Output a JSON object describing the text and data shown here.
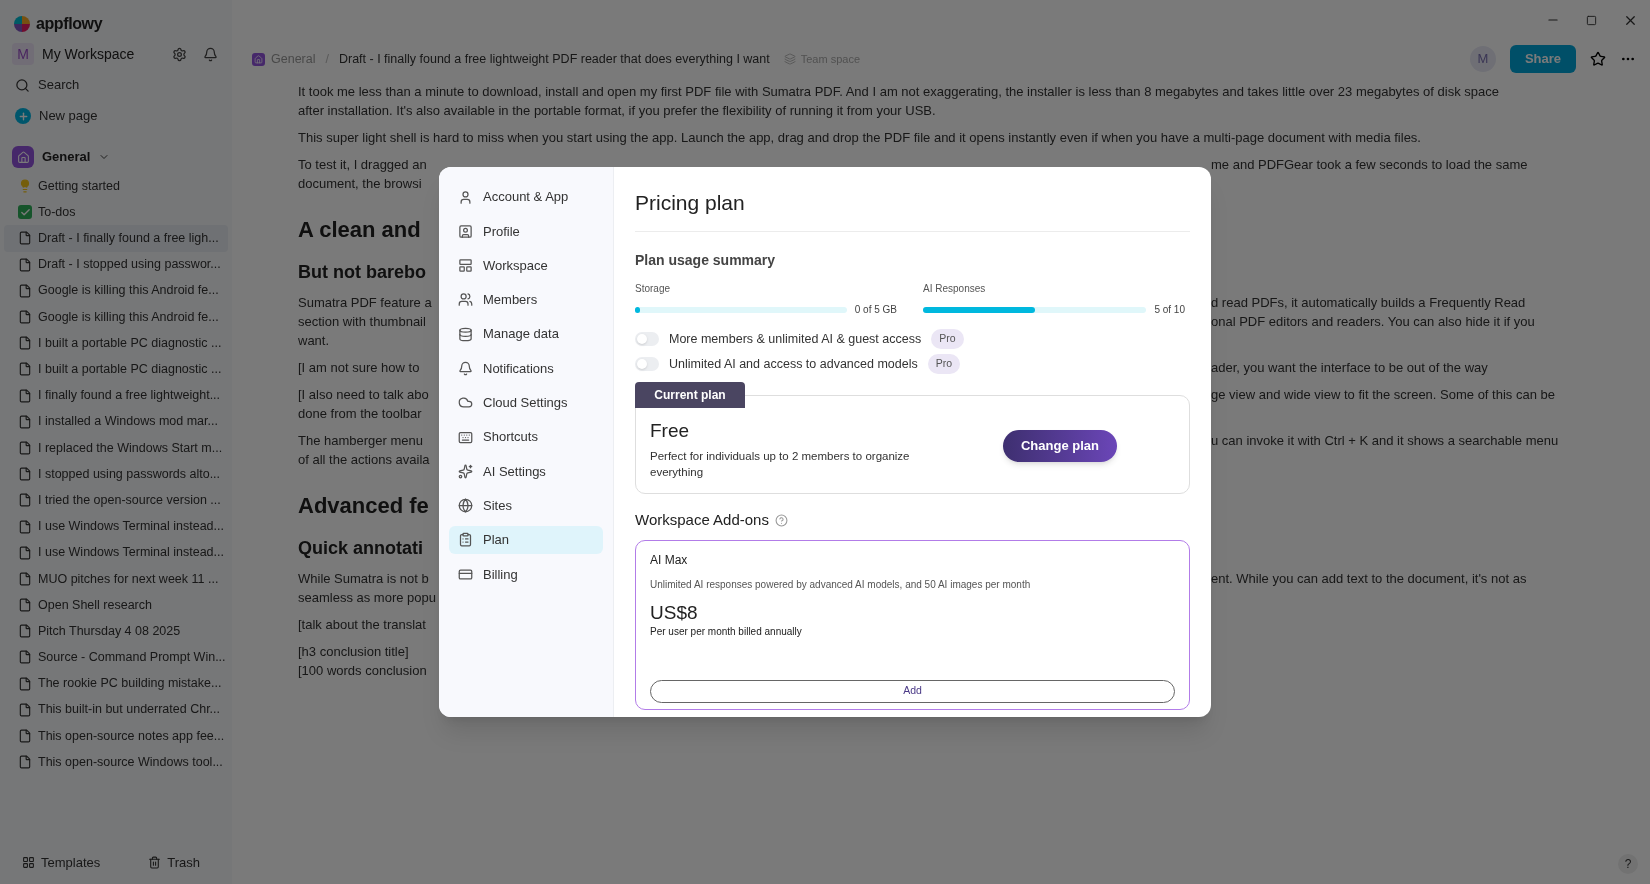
{
  "app": {
    "logo_text": "appflowy"
  },
  "sidebar": {
    "workspace": {
      "avatar": "M",
      "name": "My Workspace"
    },
    "actions": [
      {
        "label": "Search"
      },
      {
        "label": "New page"
      }
    ],
    "space": {
      "label": "General",
      "expanded": true,
      "pages": [
        {
          "label": "Getting started",
          "selected": false
        },
        {
          "label": "To-dos",
          "selected": false
        },
        {
          "label": "Draft - I finally found a free ligh...",
          "selected": true
        },
        {
          "label": "Draft - I stopped using passwor...",
          "selected": false
        },
        {
          "label": "Google is killing this Android fe...",
          "selected": false
        },
        {
          "label": "Google is killing this Android fe...",
          "selected": false
        },
        {
          "label": "I built a portable PC diagnostic ...",
          "selected": false
        },
        {
          "label": "I built a portable PC diagnostic ...",
          "selected": false
        },
        {
          "label": "I finally found a free lightweight...",
          "selected": false
        },
        {
          "label": "I installed a Windows mod mar...",
          "selected": false
        },
        {
          "label": "I replaced the Windows Start m...",
          "selected": false
        },
        {
          "label": "I stopped using passwords alto...",
          "selected": false
        },
        {
          "label": "I tried the open-source version ...",
          "selected": false
        },
        {
          "label": "I use Windows Terminal instead...",
          "selected": false
        },
        {
          "label": "I use Windows Terminal instead...",
          "selected": false
        },
        {
          "label": "MUO pitches for next week 11 ...",
          "selected": false
        },
        {
          "label": "Open Shell research",
          "selected": false
        },
        {
          "label": "Pitch Thursday 4 08 2025",
          "selected": false
        },
        {
          "label": "Source - Command Prompt Win...",
          "selected": false
        },
        {
          "label": "The rookie PC building mistake...",
          "selected": false
        },
        {
          "label": "This built-in but underrated Chr...",
          "selected": false
        },
        {
          "label": "This open-source notes app fee...",
          "selected": false
        },
        {
          "label": "This open-source Windows tool...",
          "selected": false
        }
      ]
    },
    "footer": [
      {
        "label": "Templates"
      },
      {
        "label": "Trash"
      }
    ]
  },
  "header": {
    "breadcrumbs": [
      {
        "label": "General"
      },
      {
        "label": "Draft - I finally found a free lightweight PDF reader that does everything I want"
      }
    ],
    "separator": "/",
    "badge": "Team space",
    "avatar": "M",
    "share": "Share"
  },
  "document": [
    {
      "kind": "p",
      "lines": [
        {
          "left": "It took me less than a minute to download, install and open my first PDF file with Sumatra PDF. And I am not exaggerating, the installer is less than 8 megabytes and takes little over 23 megabytes of disk space"
        },
        {
          "left": "after installation. It's also available in the portable format, if you prefer the flexibility of running it from your USB."
        }
      ]
    },
    {
      "kind": "p",
      "lines": [
        {
          "left": "This super light shell is hard to miss when you start using the app. Launch the app, drag and drop the PDF file and it opens instantly even if when you have a multi-page document with media files."
        }
      ]
    },
    {
      "kind": "p",
      "lines": [
        {
          "left": "To test it, I dragged an",
          "right": "me and PDFGear took a few seconds to load the same"
        },
        {
          "left": "document, the browsi"
        }
      ]
    },
    {
      "kind": "h2",
      "lines": [
        {
          "left": "A clean and"
        }
      ]
    },
    {
      "kind": "h3",
      "lines": [
        {
          "left": "But not barebo"
        }
      ]
    },
    {
      "kind": "p",
      "lines": [
        {
          "left": "Sumatra PDF feature a",
          "right": "d read PDFs, it automatically builds a Frequently Read"
        },
        {
          "left": "section with thumbnail",
          "right": "onal PDF editors and readers. You can also hide it if you"
        },
        {
          "left": "want."
        }
      ]
    },
    {
      "kind": "p",
      "lines": [
        {
          "left": "[I am not sure how to",
          "right": "ader, you want the interface to be out of the way"
        }
      ]
    },
    {
      "kind": "p",
      "lines": [
        {
          "left": "[I also need to talk abo",
          "right": "ge view and wide view to fit the screen. Some of this can be"
        },
        {
          "left": "done from the toolbar"
        }
      ]
    },
    {
      "kind": "p",
      "lines": [
        {
          "left": "The hamberger menu",
          "right": "u can invoke it with Ctrl + K and it shows a searchable menu"
        },
        {
          "left": "of all the actions availa"
        }
      ]
    },
    {
      "kind": "h2",
      "lines": [
        {
          "left": "Advanced fe"
        }
      ]
    },
    {
      "kind": "h3",
      "lines": [
        {
          "left": "Quick annotati"
        }
      ]
    },
    {
      "kind": "p",
      "lines": [
        {
          "left": "While Sumatra is not b",
          "right": "ent. While you can add text to the document, it's not as"
        },
        {
          "left": "seamless as more popu"
        }
      ]
    },
    {
      "kind": "p",
      "lines": [
        {
          "left": "[talk about the translat"
        }
      ]
    },
    {
      "kind": "p",
      "lines": [
        {
          "left": "[h3 conclusion title]"
        },
        {
          "left": "[100 words conclusion"
        }
      ]
    }
  ],
  "help": "?",
  "settings_dialog": {
    "nav": [
      {
        "label": "Account & App",
        "selected": false
      },
      {
        "label": "Profile",
        "selected": false
      },
      {
        "label": "Workspace",
        "selected": false
      },
      {
        "label": "Members",
        "selected": false
      },
      {
        "label": "Manage data",
        "selected": false
      },
      {
        "label": "Notifications",
        "selected": false
      },
      {
        "label": "Cloud Settings",
        "selected": false
      },
      {
        "label": "Shortcuts",
        "selected": false
      },
      {
        "label": "AI Settings",
        "selected": false
      },
      {
        "label": "Sites",
        "selected": false
      },
      {
        "label": "Plan",
        "selected": true
      },
      {
        "label": "Billing",
        "selected": false
      }
    ],
    "title": "Pricing plan",
    "usage": {
      "title": "Plan usage summary",
      "meters": [
        {
          "label": "Storage",
          "level": 0,
          "reading": "0 of 5 GB"
        },
        {
          "label": "AI Responses",
          "level": 0.5,
          "reading": "5 of 10"
        }
      ],
      "toggles": [
        {
          "label": "More members & unlimited AI & guest access",
          "on": false,
          "badge": "Pro"
        },
        {
          "label": "Unlimited AI and access to advanced models",
          "on": false,
          "badge": "Pro"
        }
      ]
    },
    "current_plan": {
      "tab": "Current plan",
      "name": "Free",
      "description": "Perfect for individuals up to 2 members to organize everything",
      "button": "Change plan"
    },
    "addons": {
      "title": "Workspace Add-ons",
      "items": [
        {
          "name": "AI Max",
          "description": "Unlimited AI responses powered by advanced AI models, and 50 AI images per month",
          "price": "US$8",
          "price_note": "Per user per month billed annually",
          "button": "Add"
        }
      ]
    }
  }
}
